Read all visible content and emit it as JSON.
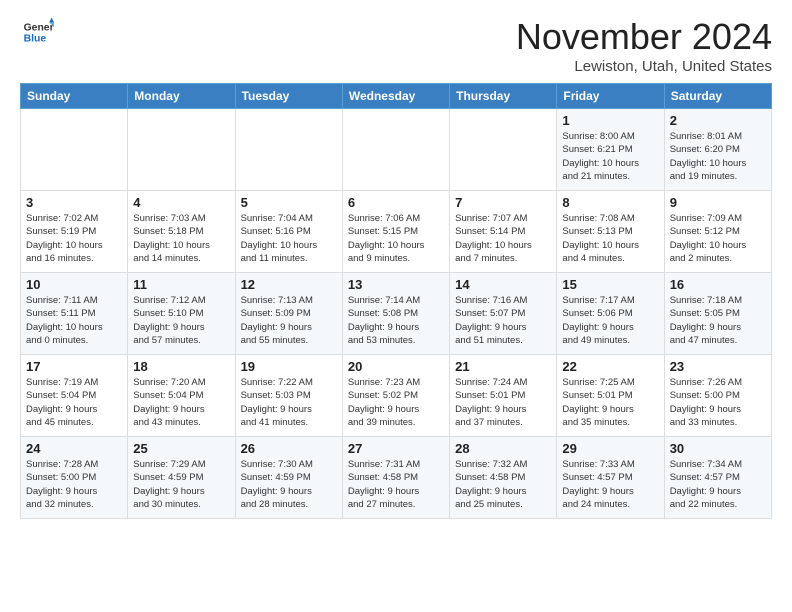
{
  "logo": {
    "general": "General",
    "blue": "Blue"
  },
  "header": {
    "month": "November 2024",
    "location": "Lewiston, Utah, United States"
  },
  "weekdays": [
    "Sunday",
    "Monday",
    "Tuesday",
    "Wednesday",
    "Thursday",
    "Friday",
    "Saturday"
  ],
  "weeks": [
    [
      {
        "day": "",
        "info": ""
      },
      {
        "day": "",
        "info": ""
      },
      {
        "day": "",
        "info": ""
      },
      {
        "day": "",
        "info": ""
      },
      {
        "day": "",
        "info": ""
      },
      {
        "day": "1",
        "info": "Sunrise: 8:00 AM\nSunset: 6:21 PM\nDaylight: 10 hours\nand 21 minutes."
      },
      {
        "day": "2",
        "info": "Sunrise: 8:01 AM\nSunset: 6:20 PM\nDaylight: 10 hours\nand 19 minutes."
      }
    ],
    [
      {
        "day": "3",
        "info": "Sunrise: 7:02 AM\nSunset: 5:19 PM\nDaylight: 10 hours\nand 16 minutes."
      },
      {
        "day": "4",
        "info": "Sunrise: 7:03 AM\nSunset: 5:18 PM\nDaylight: 10 hours\nand 14 minutes."
      },
      {
        "day": "5",
        "info": "Sunrise: 7:04 AM\nSunset: 5:16 PM\nDaylight: 10 hours\nand 11 minutes."
      },
      {
        "day": "6",
        "info": "Sunrise: 7:06 AM\nSunset: 5:15 PM\nDaylight: 10 hours\nand 9 minutes."
      },
      {
        "day": "7",
        "info": "Sunrise: 7:07 AM\nSunset: 5:14 PM\nDaylight: 10 hours\nand 7 minutes."
      },
      {
        "day": "8",
        "info": "Sunrise: 7:08 AM\nSunset: 5:13 PM\nDaylight: 10 hours\nand 4 minutes."
      },
      {
        "day": "9",
        "info": "Sunrise: 7:09 AM\nSunset: 5:12 PM\nDaylight: 10 hours\nand 2 minutes."
      }
    ],
    [
      {
        "day": "10",
        "info": "Sunrise: 7:11 AM\nSunset: 5:11 PM\nDaylight: 10 hours\nand 0 minutes."
      },
      {
        "day": "11",
        "info": "Sunrise: 7:12 AM\nSunset: 5:10 PM\nDaylight: 9 hours\nand 57 minutes."
      },
      {
        "day": "12",
        "info": "Sunrise: 7:13 AM\nSunset: 5:09 PM\nDaylight: 9 hours\nand 55 minutes."
      },
      {
        "day": "13",
        "info": "Sunrise: 7:14 AM\nSunset: 5:08 PM\nDaylight: 9 hours\nand 53 minutes."
      },
      {
        "day": "14",
        "info": "Sunrise: 7:16 AM\nSunset: 5:07 PM\nDaylight: 9 hours\nand 51 minutes."
      },
      {
        "day": "15",
        "info": "Sunrise: 7:17 AM\nSunset: 5:06 PM\nDaylight: 9 hours\nand 49 minutes."
      },
      {
        "day": "16",
        "info": "Sunrise: 7:18 AM\nSunset: 5:05 PM\nDaylight: 9 hours\nand 47 minutes."
      }
    ],
    [
      {
        "day": "17",
        "info": "Sunrise: 7:19 AM\nSunset: 5:04 PM\nDaylight: 9 hours\nand 45 minutes."
      },
      {
        "day": "18",
        "info": "Sunrise: 7:20 AM\nSunset: 5:04 PM\nDaylight: 9 hours\nand 43 minutes."
      },
      {
        "day": "19",
        "info": "Sunrise: 7:22 AM\nSunset: 5:03 PM\nDaylight: 9 hours\nand 41 minutes."
      },
      {
        "day": "20",
        "info": "Sunrise: 7:23 AM\nSunset: 5:02 PM\nDaylight: 9 hours\nand 39 minutes."
      },
      {
        "day": "21",
        "info": "Sunrise: 7:24 AM\nSunset: 5:01 PM\nDaylight: 9 hours\nand 37 minutes."
      },
      {
        "day": "22",
        "info": "Sunrise: 7:25 AM\nSunset: 5:01 PM\nDaylight: 9 hours\nand 35 minutes."
      },
      {
        "day": "23",
        "info": "Sunrise: 7:26 AM\nSunset: 5:00 PM\nDaylight: 9 hours\nand 33 minutes."
      }
    ],
    [
      {
        "day": "24",
        "info": "Sunrise: 7:28 AM\nSunset: 5:00 PM\nDaylight: 9 hours\nand 32 minutes."
      },
      {
        "day": "25",
        "info": "Sunrise: 7:29 AM\nSunset: 4:59 PM\nDaylight: 9 hours\nand 30 minutes."
      },
      {
        "day": "26",
        "info": "Sunrise: 7:30 AM\nSunset: 4:59 PM\nDaylight: 9 hours\nand 28 minutes."
      },
      {
        "day": "27",
        "info": "Sunrise: 7:31 AM\nSunset: 4:58 PM\nDaylight: 9 hours\nand 27 minutes."
      },
      {
        "day": "28",
        "info": "Sunrise: 7:32 AM\nSunset: 4:58 PM\nDaylight: 9 hours\nand 25 minutes."
      },
      {
        "day": "29",
        "info": "Sunrise: 7:33 AM\nSunset: 4:57 PM\nDaylight: 9 hours\nand 24 minutes."
      },
      {
        "day": "30",
        "info": "Sunrise: 7:34 AM\nSunset: 4:57 PM\nDaylight: 9 hours\nand 22 minutes."
      }
    ]
  ]
}
